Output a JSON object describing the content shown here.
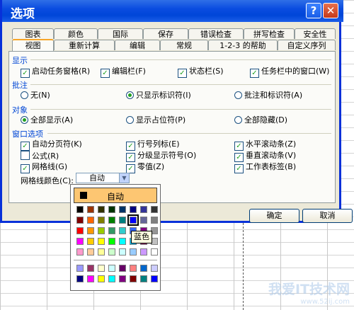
{
  "window": {
    "title": "选项"
  },
  "tabs_row1": [
    "图表",
    "颜色",
    "国际",
    "保存",
    "错误检查",
    "拼写检查",
    "安全性"
  ],
  "tabs_row2": [
    "视图",
    "重新计算",
    "编辑",
    "常规",
    "1-2-3 的帮助",
    "自定义序列"
  ],
  "sections": {
    "show": {
      "title": "显示",
      "options": [
        {
          "label": "启动任务窗格(R)",
          "checked": true
        },
        {
          "label": "编辑栏(F)",
          "checked": true
        },
        {
          "label": "状态栏(S)",
          "checked": true
        },
        {
          "label": "任务栏中的窗口(W)",
          "checked": true
        }
      ]
    },
    "comments": {
      "title": "批注",
      "options": [
        {
          "label": "无(N)",
          "selected": false
        },
        {
          "label": "只显示标识符(I)",
          "selected": true
        },
        {
          "label": "批注和标识符(A)",
          "selected": false
        }
      ]
    },
    "objects": {
      "title": "对象",
      "options": [
        {
          "label": "全部显示(A)",
          "selected": true
        },
        {
          "label": "显示占位符(P)",
          "selected": false
        },
        {
          "label": "全部隐藏(D)",
          "selected": false
        }
      ]
    },
    "window_options": {
      "title": "窗口选项",
      "options": [
        {
          "label": "自动分页符(K)",
          "checked": true
        },
        {
          "label": "行号列标(E)",
          "checked": true
        },
        {
          "label": "水平滚动条(Z)",
          "checked": true
        },
        {
          "label": "公式(R)",
          "checked": false
        },
        {
          "label": "分级显示符号(O)",
          "checked": true
        },
        {
          "label": "垂直滚动条(V)",
          "checked": true
        },
        {
          "label": "网格线(G)",
          "checked": true
        },
        {
          "label": "零值(Z)",
          "checked": true
        },
        {
          "label": "工作表标签(B)",
          "checked": true
        }
      ]
    }
  },
  "gridline_color": {
    "label": "网格线颜色(C):",
    "value": "自动"
  },
  "buttons": {
    "ok": "确定",
    "cancel": "取消"
  },
  "palette": {
    "auto_label": "自动",
    "tooltip": "蓝色",
    "selected_color": "#0000ff",
    "rows": [
      [
        "#000000",
        "#993300",
        "#333300",
        "#003300",
        "#003366",
        "#000080",
        "#333399",
        "#333333"
      ],
      [
        "#800000",
        "#ff6600",
        "#808000",
        "#008000",
        "#008080",
        "#0000ff",
        "#666699",
        "#808080"
      ],
      [
        "#ff0000",
        "#ff9900",
        "#99cc00",
        "#339966",
        "#33cccc",
        "#3366ff",
        "#800080",
        "#969696"
      ],
      [
        "#ff00ff",
        "#ffcc00",
        "#ffff00",
        "#00ff00",
        "#00ffff",
        "#00ccff",
        "#993366",
        "#c0c0c0"
      ],
      [
        "#ff99cc",
        "#ffcc99",
        "#ffff99",
        "#ccffcc",
        "#ccffff",
        "#99ccff",
        "#cc99ff",
        "#ffffff"
      ]
    ],
    "extra_rows": [
      [
        "#9999ff",
        "#993366",
        "#ffffcc",
        "#ccffff",
        "#660066",
        "#ff8080",
        "#0066cc",
        "#ccccff"
      ],
      [
        "#000080",
        "#ff00ff",
        "#ffff00",
        "#00ffff",
        "#800080",
        "#800000",
        "#008080",
        "#0000ff"
      ]
    ]
  },
  "watermark": {
    "line1": "我爱IT技术网",
    "line2": "www.52ij.com"
  }
}
